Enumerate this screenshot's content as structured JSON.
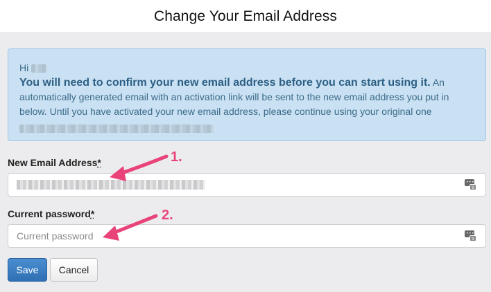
{
  "header": {
    "title": "Change Your Email Address"
  },
  "notice": {
    "greeting": "Hi",
    "strong": "You will need to confirm your new email address before you can start using it.",
    "body": " An automatically generated email with an activation link will be sent to the new email address you put in below. Until you have activated your new email address, please continue using your original one"
  },
  "form": {
    "email_label": "New Email Address",
    "email_required": "*",
    "password_label": "Current password",
    "password_required": "*",
    "password_placeholder": "Current password"
  },
  "buttons": {
    "save": "Save",
    "cancel": "Cancel"
  },
  "annotations": {
    "step1": "1.",
    "step2": "2."
  },
  "colors": {
    "accent": "#e8447a",
    "notice_bg": "#c9e1f2",
    "save_button": "#2f6fb3"
  },
  "icons": {
    "password_manager": "password-manager-icon",
    "arrow": "annotation-arrow"
  }
}
